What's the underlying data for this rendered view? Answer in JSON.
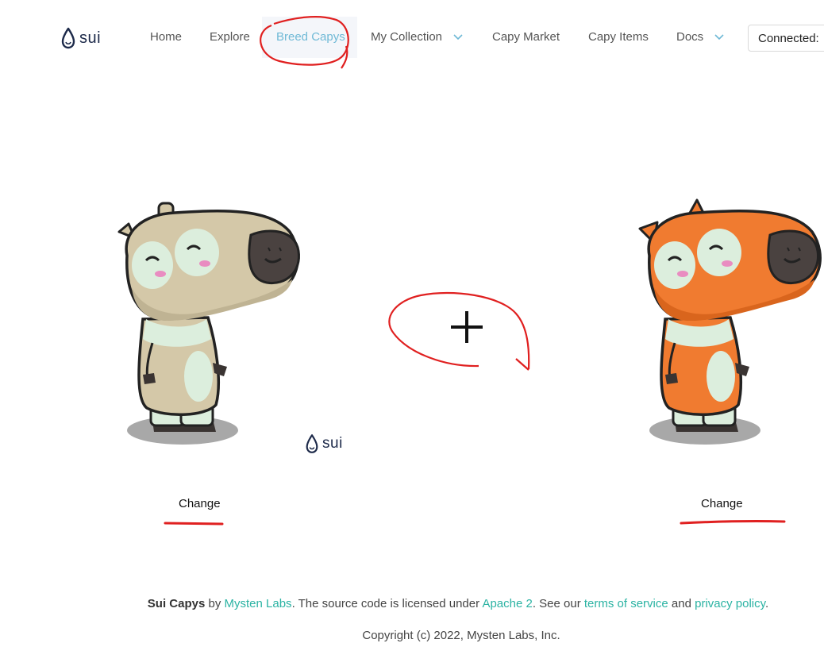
{
  "header": {
    "logo_text": "sui",
    "nav": [
      {
        "label": "Home"
      },
      {
        "label": "Explore"
      },
      {
        "label": "Breed Capys",
        "active": true
      },
      {
        "label": "My Collection",
        "dropdown": true
      },
      {
        "label": "Capy Market"
      },
      {
        "label": "Capy Items"
      },
      {
        "label": "Docs",
        "dropdown": true
      }
    ],
    "connect_label": "Connected:"
  },
  "main": {
    "left_capy": {
      "color": "#d4c8a8",
      "change_label": "Change"
    },
    "right_capy": {
      "color": "#f07b30",
      "change_label": "Change"
    },
    "plus_symbol": "+",
    "center_logo_text": "sui"
  },
  "footer": {
    "brand": "Sui Capys",
    "by": "by",
    "company": "Mysten Labs",
    "license_text": ". The source code is licensed under",
    "license_link": "Apache 2",
    "see_text": ". See our",
    "terms_link": "terms of service",
    "and_text": "and",
    "privacy_link": "privacy policy",
    "period": ".",
    "copyright": "Copyright (c) 2022, Mysten Labs, Inc."
  },
  "colors": {
    "accent": "#2bb3a3",
    "nav_active": "#6fb9d6",
    "annotation": "#e02020",
    "logo": "#1d2a4a"
  },
  "icons": {
    "logo": "sui-drop-icon",
    "dropdown": "chevron-down-icon",
    "plus": "plus-icon"
  }
}
